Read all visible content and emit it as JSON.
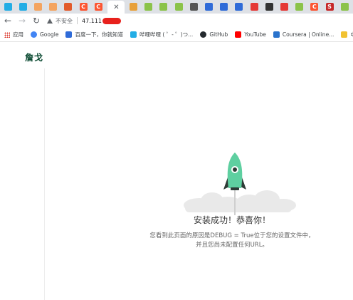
{
  "tabs": [
    {
      "icon": "bilibili-icon",
      "color": "#23ade5",
      "glyph": ""
    },
    {
      "icon": "bilibili-icon",
      "color": "#23ade5",
      "glyph": ""
    },
    {
      "icon": "code-icon",
      "color": "#f4a460",
      "glyph": ""
    },
    {
      "icon": "code-icon",
      "color": "#f4a460",
      "glyph": ""
    },
    {
      "icon": "flame-icon",
      "color": "#e25b2b",
      "glyph": ""
    },
    {
      "icon": "csdn-icon",
      "color": "#fc5531",
      "glyph": "C"
    },
    {
      "icon": "csdn-icon",
      "color": "#fc5531",
      "glyph": "C"
    },
    {
      "icon": "close-icon",
      "active": true,
      "glyph": "✕"
    },
    {
      "icon": "chart-icon",
      "color": "#e8a13b",
      "glyph": ""
    },
    {
      "icon": "android-icon",
      "color": "#8bc34a",
      "glyph": ""
    },
    {
      "icon": "android-icon",
      "color": "#8bc34a",
      "glyph": ""
    },
    {
      "icon": "android-icon",
      "color": "#8bc34a",
      "glyph": ""
    },
    {
      "icon": "book-icon",
      "color": "#555555",
      "glyph": ""
    },
    {
      "icon": "paw-icon",
      "color": "#2f6bd8",
      "glyph": ""
    },
    {
      "icon": "paw-icon",
      "color": "#2f6bd8",
      "glyph": ""
    },
    {
      "icon": "paw-icon",
      "color": "#2f6bd8",
      "glyph": ""
    },
    {
      "icon": "colorful-icon",
      "color": "#e53935",
      "glyph": ""
    },
    {
      "icon": "omega-icon",
      "color": "#333333",
      "glyph": ""
    },
    {
      "icon": "home-icon",
      "color": "#e53935",
      "glyph": ""
    },
    {
      "icon": "android-icon",
      "color": "#8bc34a",
      "glyph": ""
    },
    {
      "icon": "csdn-icon",
      "color": "#fc5531",
      "glyph": "C"
    },
    {
      "icon": "s-icon",
      "color": "#c62828",
      "glyph": "S"
    },
    {
      "icon": "android-icon",
      "color": "#8bc34a",
      "glyph": ""
    }
  ],
  "toolbar": {
    "insecure_label": "不安全",
    "url": "47.111"
  },
  "bookmarks": [
    {
      "label": "应用",
      "icon": "apps-icon",
      "color": "#d93025"
    },
    {
      "label": "Google",
      "icon": "google-icon",
      "color": "#4285f4"
    },
    {
      "label": "百度一下，你就知道",
      "icon": "baidu-icon",
      "color": "#2f6bd8"
    },
    {
      "label": "哔哩哔哩 ( ゜- ゜)つ...",
      "icon": "bilibili-icon",
      "color": "#23ade5"
    },
    {
      "label": "GitHub",
      "icon": "github-icon",
      "color": "#24292e"
    },
    {
      "label": "YouTube",
      "icon": "youtube-icon",
      "color": "#ff0000"
    },
    {
      "label": "Coursera | Online...",
      "icon": "coursera-icon",
      "color": "#2a73cc"
    },
    {
      "label": "中",
      "icon": "folder-icon",
      "color": "#f1c232"
    }
  ],
  "page": {
    "brand": "詹戈",
    "headline": "安装成功！恭喜你！",
    "description": "您看到此页面的原因是DEBUG = True位于您的设置文件中，并且您尚未配置任何URL。"
  },
  "colors": {
    "brand": "#0c4b33",
    "rocket_body": "#5ecfa0",
    "rocket_fin": "#2d3b36",
    "cloud": "#e4e4e4"
  }
}
